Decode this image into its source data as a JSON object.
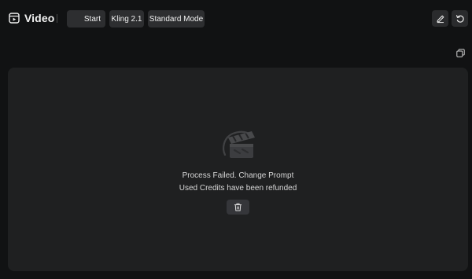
{
  "header": {
    "title": "Video",
    "title_icon": "video-square-icon",
    "chips": {
      "start": "Start",
      "model": "Kling 2.1",
      "mode": "Standard Mode"
    },
    "actions": {
      "edit_icon": "pencil-icon",
      "reset_icon": "rotate-ccw-icon"
    }
  },
  "toolbar": {
    "copy_icon": "copy-icon"
  },
  "result_panel": {
    "status_icon": "failed-video-icon",
    "message_line1": "Process Failed. Change Prompt",
    "message_line2": "Used Credits have been refunded",
    "delete_icon": "trash-icon"
  },
  "colors": {
    "background": "#111213",
    "panel": "#1f2021",
    "chip": "#2d2e30",
    "text": "#e6e6e6"
  }
}
